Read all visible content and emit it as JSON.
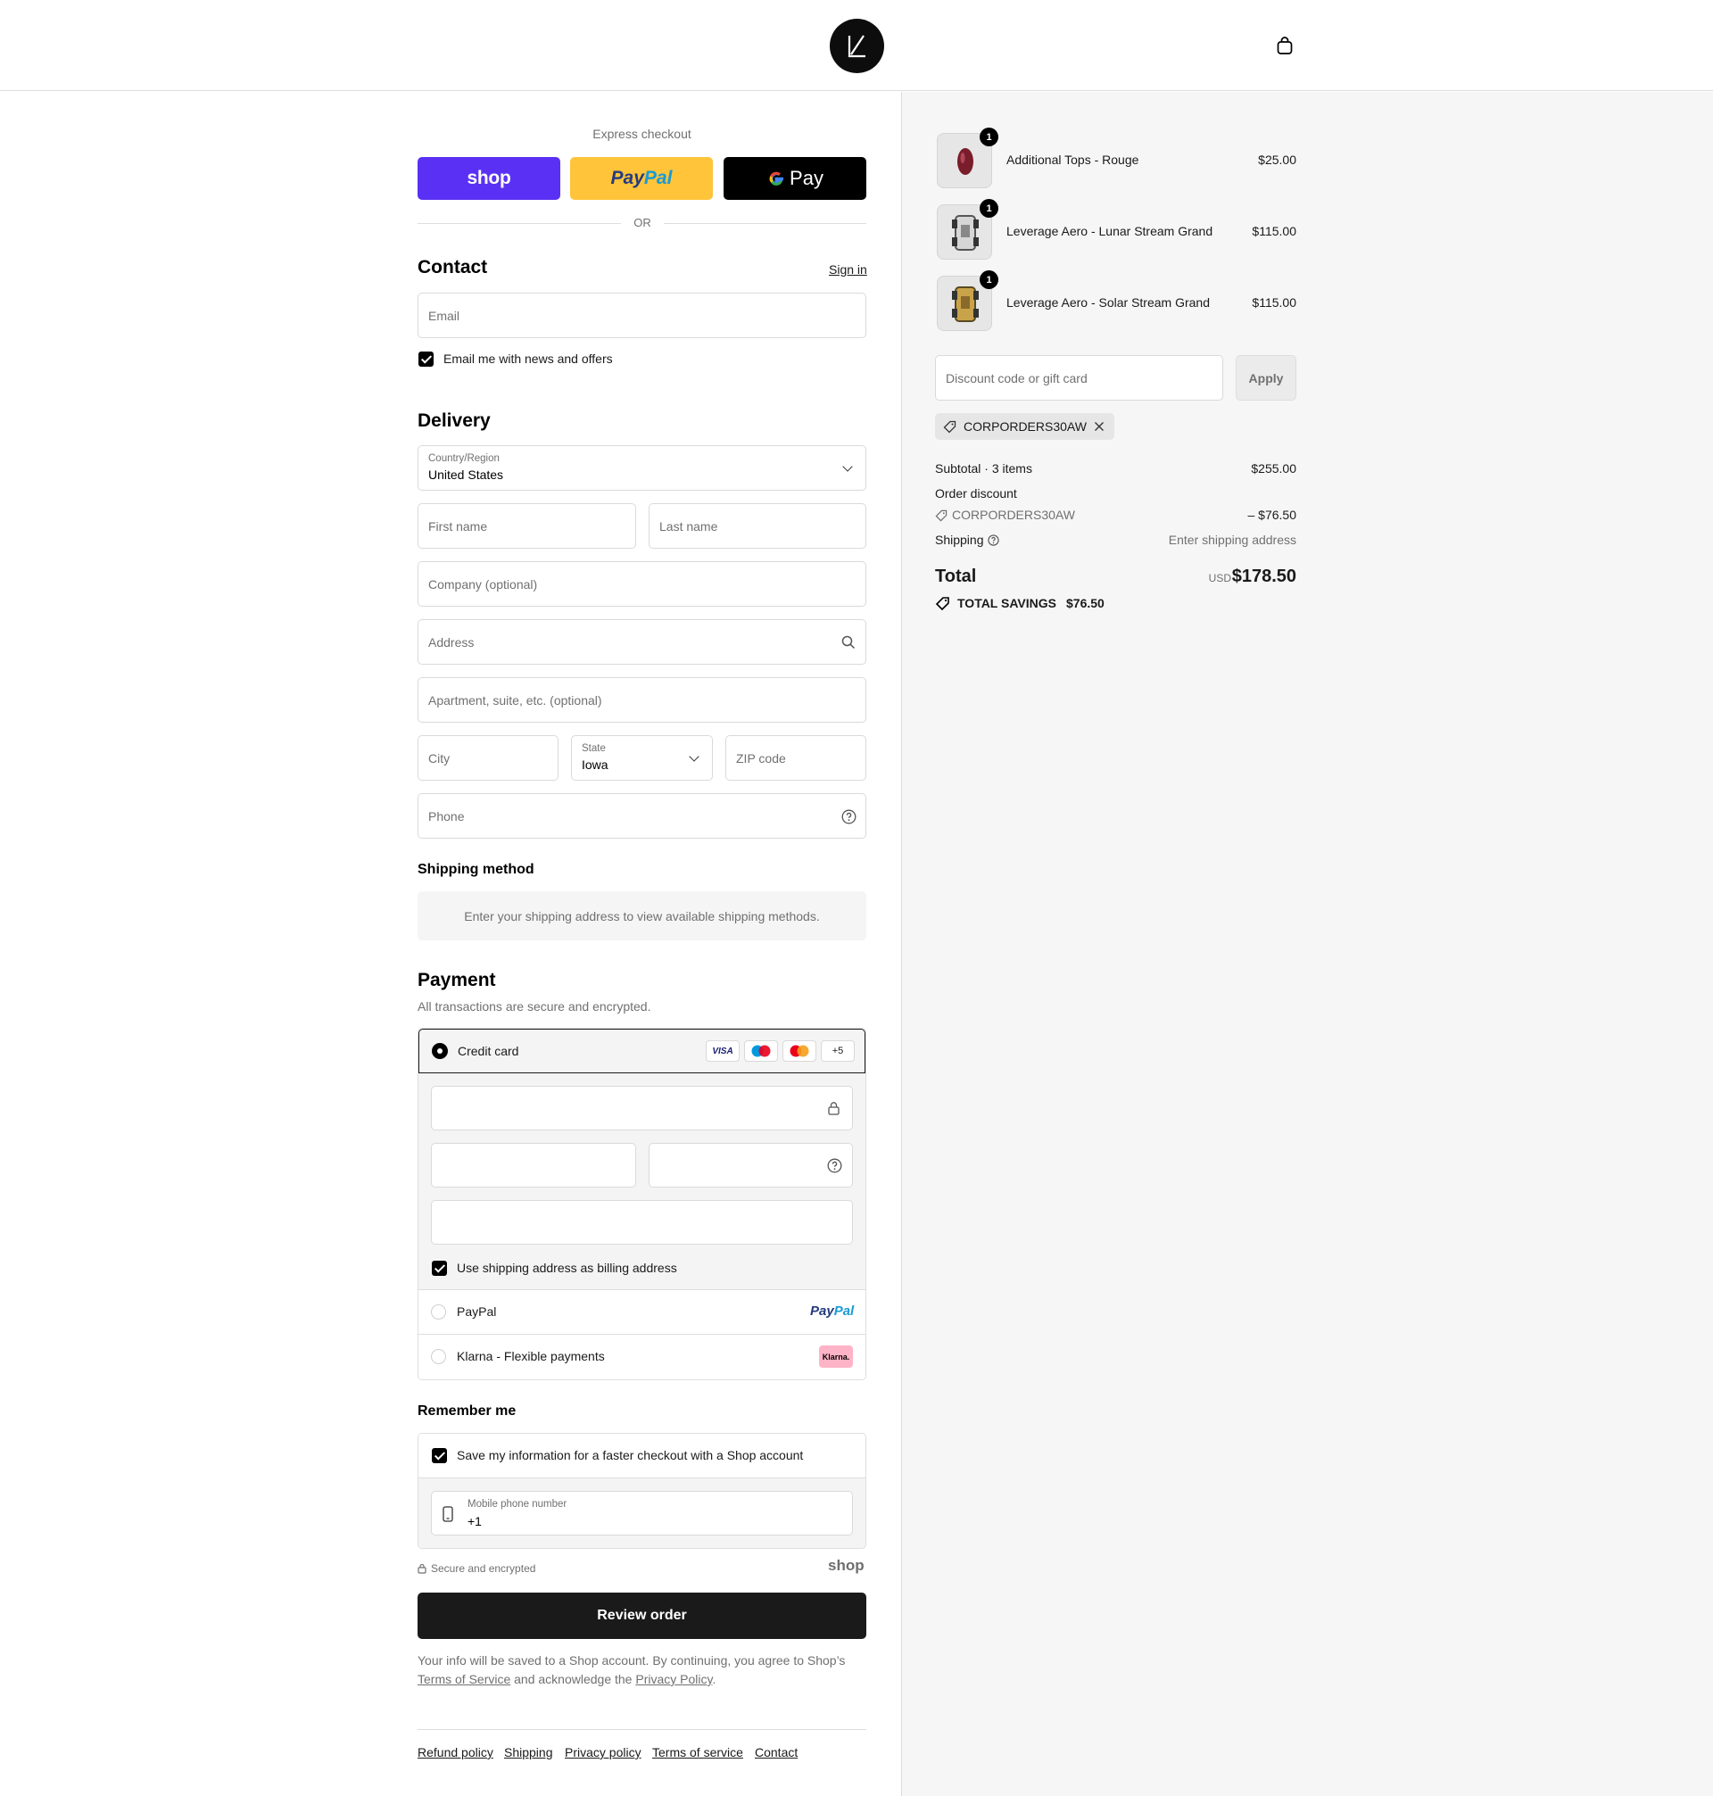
{
  "header": {
    "logo_alt": "store-logo",
    "cart_icon": "shopping-bag-icon"
  },
  "express": {
    "title": "Express checkout",
    "shop_label": "shop",
    "paypal_label_pay": "Pay",
    "paypal_label_pal": "Pal",
    "gpay_label": "Pay",
    "or_label": "OR",
    "colors": {
      "shop": "#5a31f4",
      "paypal": "#ffc439",
      "gpay": "#000000"
    }
  },
  "contact": {
    "title": "Contact",
    "sign_in": "Sign in",
    "email_placeholder": "Email",
    "newsletter_label": "Email me with news and offers"
  },
  "delivery": {
    "title": "Delivery",
    "country_label": "Country/Region",
    "country_value": "United States",
    "first_name": "First name",
    "last_name": "Last name",
    "company": "Company (optional)",
    "address": "Address",
    "apartment": "Apartment, suite, etc. (optional)",
    "city": "City",
    "state_label": "State",
    "state_value": "Iowa",
    "zip": "ZIP code",
    "phone": "Phone"
  },
  "shipping_method": {
    "title": "Shipping method",
    "notice": "Enter your shipping address to view available shipping methods."
  },
  "payment": {
    "title": "Payment",
    "subtitle": "All transactions are secure and encrypted.",
    "credit_card_label": "Credit card",
    "card_badges": [
      "VISA",
      "maestro",
      "mastercard",
      "+5"
    ],
    "billing_same_label": "Use shipping address as billing address",
    "paypal_label": "PayPal",
    "paypal_logo_pay": "Pay",
    "paypal_logo_pal": "Pal",
    "klarna_label": "Klarna - Flexible payments",
    "klarna_logo": "Klarna."
  },
  "remember": {
    "title": "Remember me",
    "save_label": "Save my information for a faster checkout with a Shop account",
    "phone_label": "Mobile phone number",
    "phone_value": "+1",
    "secure_label": "Secure and encrypted",
    "shop_logo": "shop"
  },
  "review_button": "Review order",
  "legal": {
    "line1": "Your info will be saved to a Shop account. By continuing, you agree to Shop’s",
    "terms": "Terms of Service",
    "and_ack": " and acknowledge the ",
    "privacy": "Privacy Policy",
    "end": "."
  },
  "footer_links": [
    "Refund policy",
    "Shipping",
    "Privacy policy",
    "Terms of service",
    "Contact"
  ],
  "summary": {
    "items": [
      {
        "name": "Additional Tops - Rouge",
        "price": "$25.00",
        "qty": "1",
        "color": "#7a1d2a"
      },
      {
        "name": "Leverage Aero - Lunar Stream Grand",
        "price": "$115.00",
        "qty": "1",
        "color": "#c8c8c8"
      },
      {
        "name": "Leverage Aero - Solar Stream Grand",
        "price": "$115.00",
        "qty": "1",
        "color": "#b8923a"
      }
    ],
    "discount_placeholder": "Discount code or gift card",
    "apply": "Apply",
    "applied_code": "CORPORDERS30AW",
    "subtotal_label": "Subtotal · 3 items",
    "subtotal_value": "$255.00",
    "order_discount_label": "Order discount",
    "discount_code": "CORPORDERS30AW",
    "discount_value": "– $76.50",
    "shipping_label": "Shipping",
    "shipping_value": "Enter shipping address",
    "total_label": "Total",
    "currency": "USD",
    "total_value": "$178.50",
    "savings_label": "TOTAL SAVINGS",
    "savings_value": "$76.50"
  }
}
